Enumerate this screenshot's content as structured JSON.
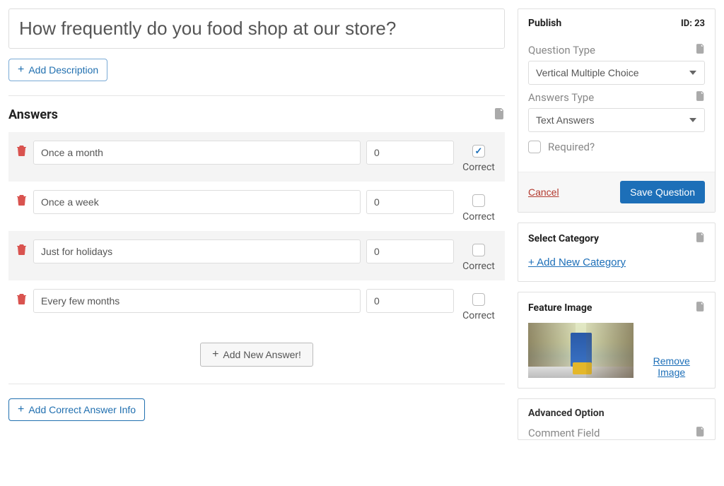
{
  "question": {
    "title": "How frequently do you food shop at our store?",
    "add_description": "Add Description"
  },
  "answers": {
    "heading": "Answers",
    "items": [
      {
        "text": "Once a month",
        "score": "0",
        "correct": true
      },
      {
        "text": "Once a week",
        "score": "0",
        "correct": false
      },
      {
        "text": "Just for holidays",
        "score": "0",
        "correct": false
      },
      {
        "text": "Every few months",
        "score": "0",
        "correct": false
      }
    ],
    "correct_label": "Correct",
    "add_new_answer": "Add New Answer!",
    "add_correct_info": "Add Correct Answer Info"
  },
  "publish": {
    "heading": "Publish",
    "id_label": "ID: 23",
    "question_type_label": "Question Type",
    "question_type_value": "Vertical Multiple Choice",
    "answers_type_label": "Answers Type",
    "answers_type_value": "Text Answers",
    "required_label": "Required?",
    "cancel": "Cancel",
    "save": "Save Question"
  },
  "category": {
    "heading": "Select Category",
    "add_new": "+ Add New Category"
  },
  "feature_image": {
    "heading": "Feature Image",
    "remove": "Remove Image"
  },
  "advanced": {
    "heading": "Advanced Option",
    "comment_field_label": "Comment Field"
  }
}
